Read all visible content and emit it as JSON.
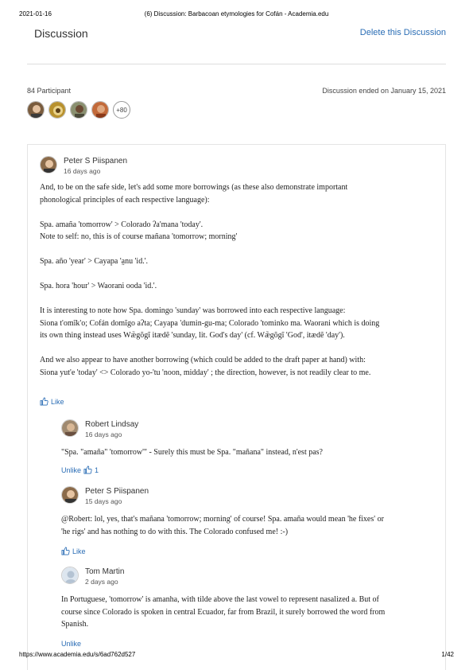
{
  "print": {
    "date": "2021-01-16",
    "title": "(6) Discussion: Barbacoan etymologies for Cofán - Academia.edu",
    "url": "https://www.academia.edu/s/6ad762d527",
    "page": "1/42"
  },
  "header": {
    "title": "Discussion",
    "delete_label": "Delete this Discussion"
  },
  "meta": {
    "participants": "84 Participant",
    "ended": "Discussion ended on January 15, 2021",
    "more_label": "+80"
  },
  "comments": [
    {
      "author": "Peter S Piispanen",
      "time": "16 days ago",
      "paragraphs": [
        "And, to be on the safe side, let's add some more borrowings (as these also demonstrate important",
        "phonological principles of each respective language):",
        "",
        "Spa. amaña 'tomorrow' > Colorado ʔa'mana 'today'.",
        "Note to self: no, this is of course mañana 'tomorrow; morning'",
        "",
        "Spa. año 'year' > Cayapa 'a̤nu 'id.'.",
        "",
        "Spa. hora 'hour' > Waorani ooda 'id.'.",
        "",
        "It is interesting to note how Spa. domingo 'sunday' was borrowed into each respective language:",
        "Siona t'omĩk'o; Cofán domĩgo aʔta; Cayapa 'dumin-gu-ma; Colorado 'tominko ma. Waorani which is doing",
        "its own thing instead uses Wæ̃gõgĩ itædẽ 'sunday, lit. God's day' (cf. Wæ̃gõgĩ 'God', itædẽ 'day').",
        "",
        "And we also appear to have another borrowing (which could be added to the draft paper at hand) with:",
        "Siona yut'e 'today' <> Colorado yo-'tu 'noon, midday' ; the direction, however, is not readily clear to me."
      ],
      "action": "Like",
      "count": ""
    },
    {
      "author": "Robert Lindsay",
      "time": "16 days ago",
      "paragraphs": [
        "\"Spa. \"amaña\" 'tomorrow'\" - Surely this must be Spa. \"mañana\" instead, n'est pas?"
      ],
      "action": "Unlike",
      "count": "1"
    },
    {
      "author": "Peter S Piispanen",
      "time": "15 days ago",
      "paragraphs": [
        "@Robert: lol, yes, that's mañana 'tomorrow; morning' of course! Spa. amaña would mean 'he fixes' or",
        "'he rigs' and has nothing to do with this. The Colorado confused me! :-)"
      ],
      "action": "Like",
      "count": ""
    },
    {
      "author": "Tom Martin",
      "time": "2 days ago",
      "paragraphs": [
        "In Portuguese, 'tomorrow' is amanha, with tilde above the last vowel to represent nasalized a. But of",
        "course since Colorado is spoken in central Ecuador, far from Brazil, it surely borrowed the word from",
        "Spanish."
      ],
      "action": "Unlike",
      "count": ""
    }
  ]
}
